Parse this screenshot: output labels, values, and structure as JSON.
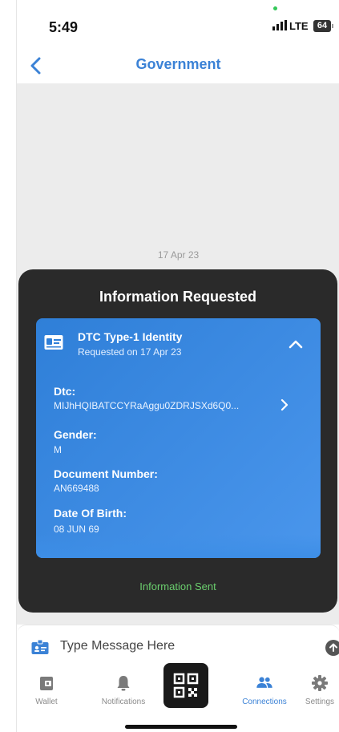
{
  "status_bar": {
    "time": "5:49",
    "network": "LTE",
    "battery": "64"
  },
  "nav": {
    "title": "Government"
  },
  "chat": {
    "date_separator": "17 Apr 23"
  },
  "request": {
    "title": "Information Requested",
    "credential": {
      "name": "DTC Type-1 Identity",
      "requested_on": "Requested on 17 Apr 23",
      "attributes": [
        {
          "label": "Dtc:",
          "value": "MIJhHQIBATCCYRaAggu0ZDRJSXd6Q0..."
        },
        {
          "label": "Gender:",
          "value": "M"
        },
        {
          "label": "Document Number:",
          "value": "AN669488"
        },
        {
          "label": "Date Of Birth:",
          "value": "08 JUN 69"
        }
      ]
    },
    "status": "Information Sent"
  },
  "composer": {
    "placeholder": "Type Message Here"
  },
  "tabs": {
    "wallet": "Wallet",
    "notifications": "Notifications",
    "connections": "Connections",
    "settings": "Settings"
  },
  "colors": {
    "accent": "#3b82d6",
    "card_bg": "#2a2a2a",
    "success": "#6bcf6e"
  }
}
